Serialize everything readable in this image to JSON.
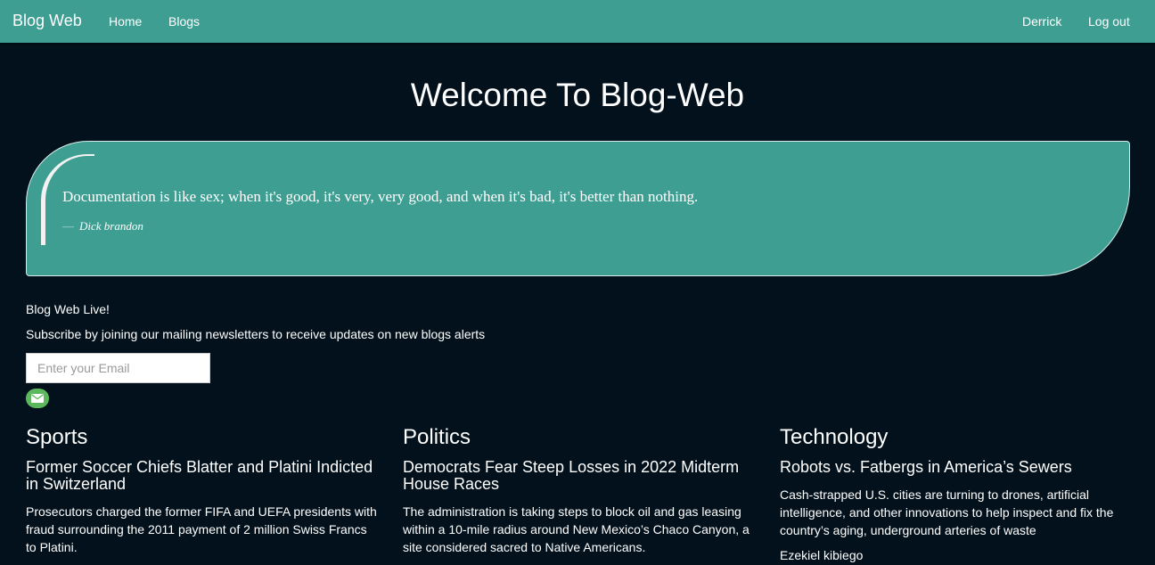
{
  "nav": {
    "brand": "Blog Web",
    "home": "Home",
    "blogs": "Blogs",
    "user": "Derrick",
    "logout": "Log out"
  },
  "hero": {
    "title": "Welcome To Blog-Web"
  },
  "quote": {
    "text": "Documentation is like sex; when it's good, it's very, very good, and when it's bad, it's better than nothing.",
    "dash": "—",
    "author": "Dick brandon"
  },
  "newsletter": {
    "heading": "Blog Web Live!",
    "description": "Subscribe by joining our mailing newsletters to receive updates on new blogs alerts",
    "email_placeholder": "Enter your Email",
    "button_icon": "envelope-icon"
  },
  "categories": [
    {
      "name": "Sports",
      "headline": "Former Soccer Chiefs Blatter and Platini Indicted in Switzerland",
      "summary": "Prosecutors charged the former FIFA and UEFA presidents with fraud surrounding the 2011 payment of 2 million Swiss Francs to Platini."
    },
    {
      "name": "Politics",
      "headline": "Democrats Fear Steep Losses in 2022 Midterm House Races",
      "summary": "The administration is taking steps to block oil and gas leasing within a 10-mile radius around New Mexico’s Chaco Canyon, a site considered sacred to Native Americans."
    },
    {
      "name": "Technology",
      "headline": "Robots vs. Fatbergs in America’s Sewers",
      "summary": "Cash-strapped U.S. cities are turning to drones, artificial intelligence, and other innovations to help inspect and fix the country’s aging, underground arteries of waste",
      "author": "Ezekiel kibiego"
    }
  ],
  "colors": {
    "navbar": "#3e9e92",
    "background": "#02111b",
    "quote_card": "#3e9e92",
    "mail_button": "#5cb85c"
  }
}
